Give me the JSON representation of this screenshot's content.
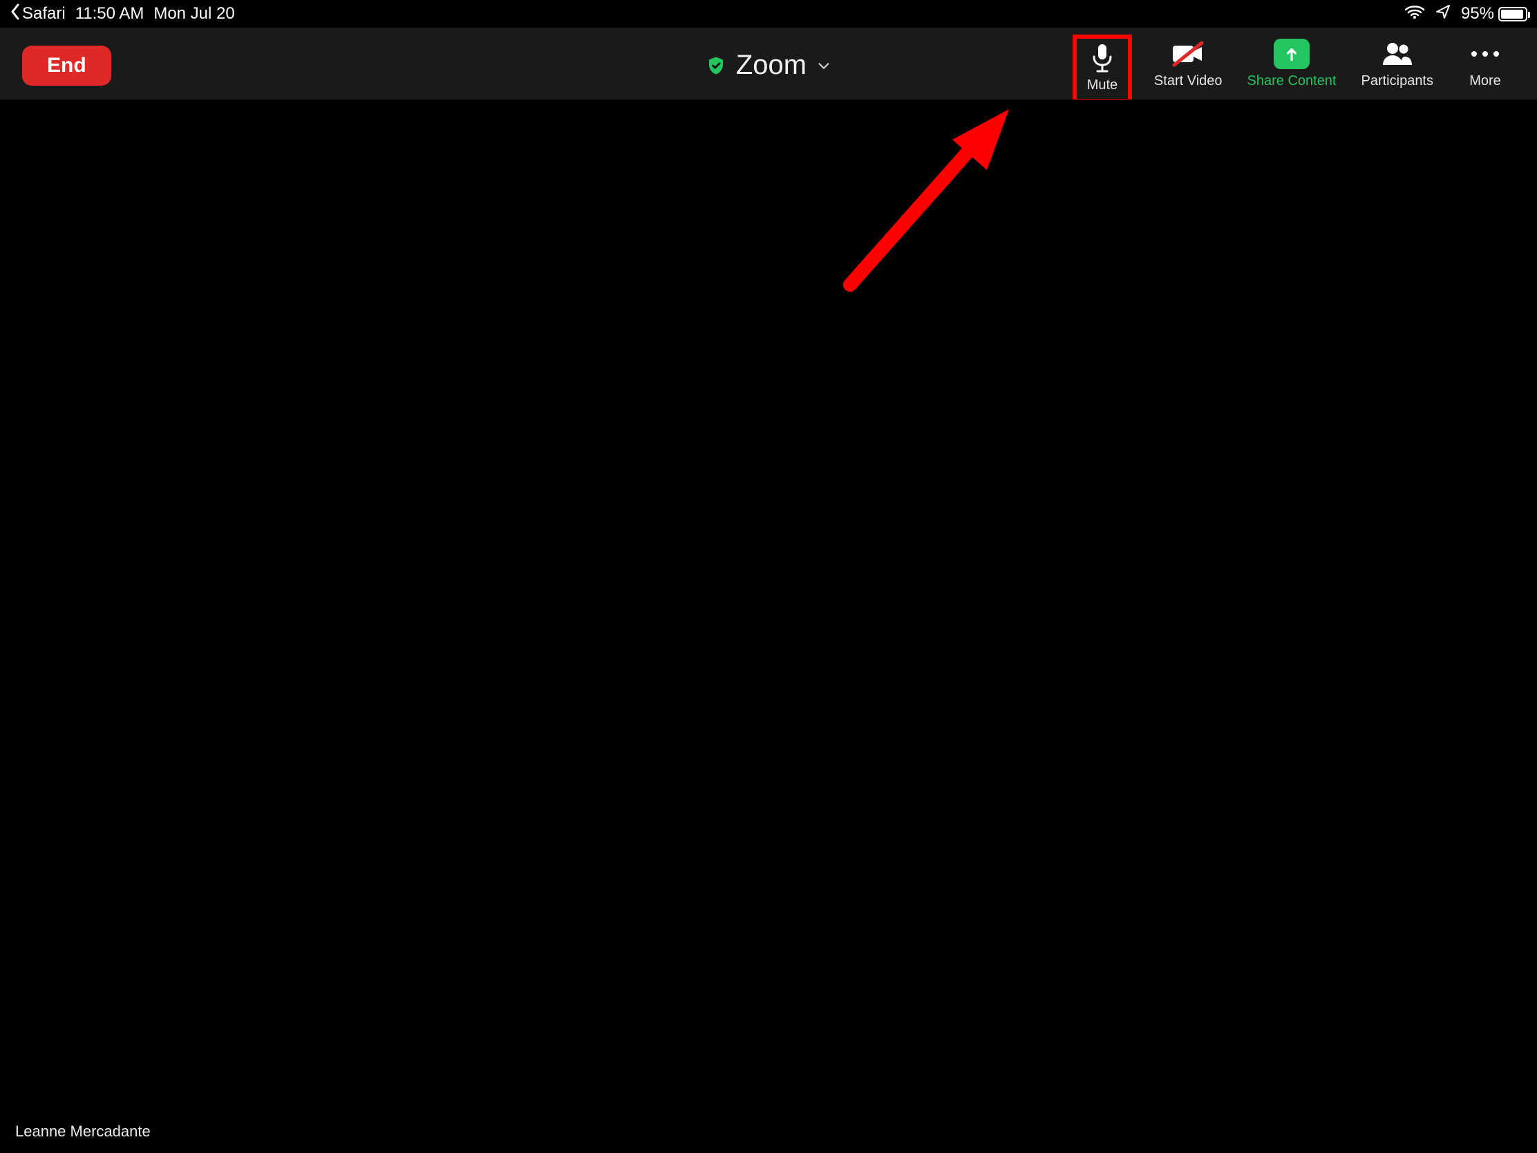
{
  "statusbar": {
    "back_app": "Safari",
    "time": "11:50 AM",
    "date": "Mon Jul 20",
    "battery_pct": "95%"
  },
  "toolbar": {
    "end_label": "End",
    "title": "Zoom",
    "controls": {
      "mute": "Mute",
      "start_video": "Start Video",
      "share_content": "Share Content",
      "participants": "Participants",
      "more": "More"
    }
  },
  "stage": {
    "participant": "Leanne Mercadante"
  },
  "annotation": {
    "highlight_target": "mute-button",
    "arrow_color": "#ff0000"
  }
}
